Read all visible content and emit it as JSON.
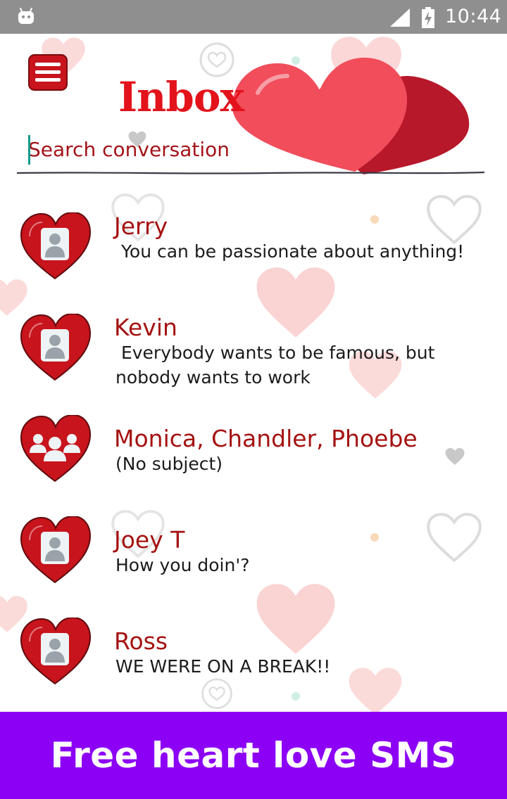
{
  "status_bar": {
    "time": "10:44"
  },
  "header": {
    "title": "Inbox"
  },
  "search": {
    "placeholder": "Search conversation"
  },
  "conversations": [
    {
      "name": "Jerry",
      "preview": " You can be passionate about anything!",
      "avatar": "single-person-icon"
    },
    {
      "name": "Kevin",
      "preview": " Everybody wants to be famous, but nobody wants to work",
      "avatar": "single-person-icon"
    },
    {
      "name": "Monica, Chandler, Phoebe",
      "preview": "(No subject)",
      "avatar": "group-icon"
    },
    {
      "name": "Joey T",
      "preview": "How you doin'?",
      "avatar": "single-person-icon"
    },
    {
      "name": "Ross",
      "preview": "WE WERE ON A BREAK!!",
      "avatar": "single-person-icon"
    }
  ],
  "banner": {
    "text": "Free heart love SMS"
  },
  "colors": {
    "accent": "#e3131b",
    "name_text": "#a51212",
    "banner_bg": "#8c00f5",
    "status_bar": "#8f8f8f"
  }
}
